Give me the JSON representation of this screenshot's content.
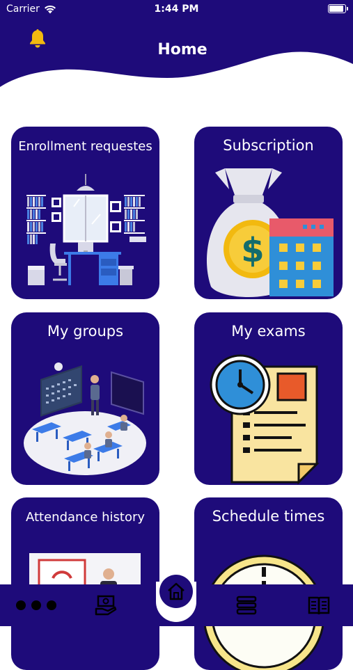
{
  "status_bar": {
    "carrier": "Carrier",
    "time": "1:44 PM"
  },
  "header": {
    "title": "Home"
  },
  "cards": [
    {
      "title": "Enrollment requestes"
    },
    {
      "title": "Subscription"
    },
    {
      "title": "My groups"
    },
    {
      "title": "My exams"
    },
    {
      "title": "Attendance history"
    },
    {
      "title": "Schedule times"
    }
  ],
  "bottom_nav": {
    "items": [
      "more-icon",
      "payments-icon",
      "home-icon",
      "layers-icon",
      "book-icon"
    ],
    "selected": "home-icon"
  },
  "colors": {
    "primary": "#1e0b7a",
    "accent": "#f2b90f",
    "background": "#ffffff"
  }
}
